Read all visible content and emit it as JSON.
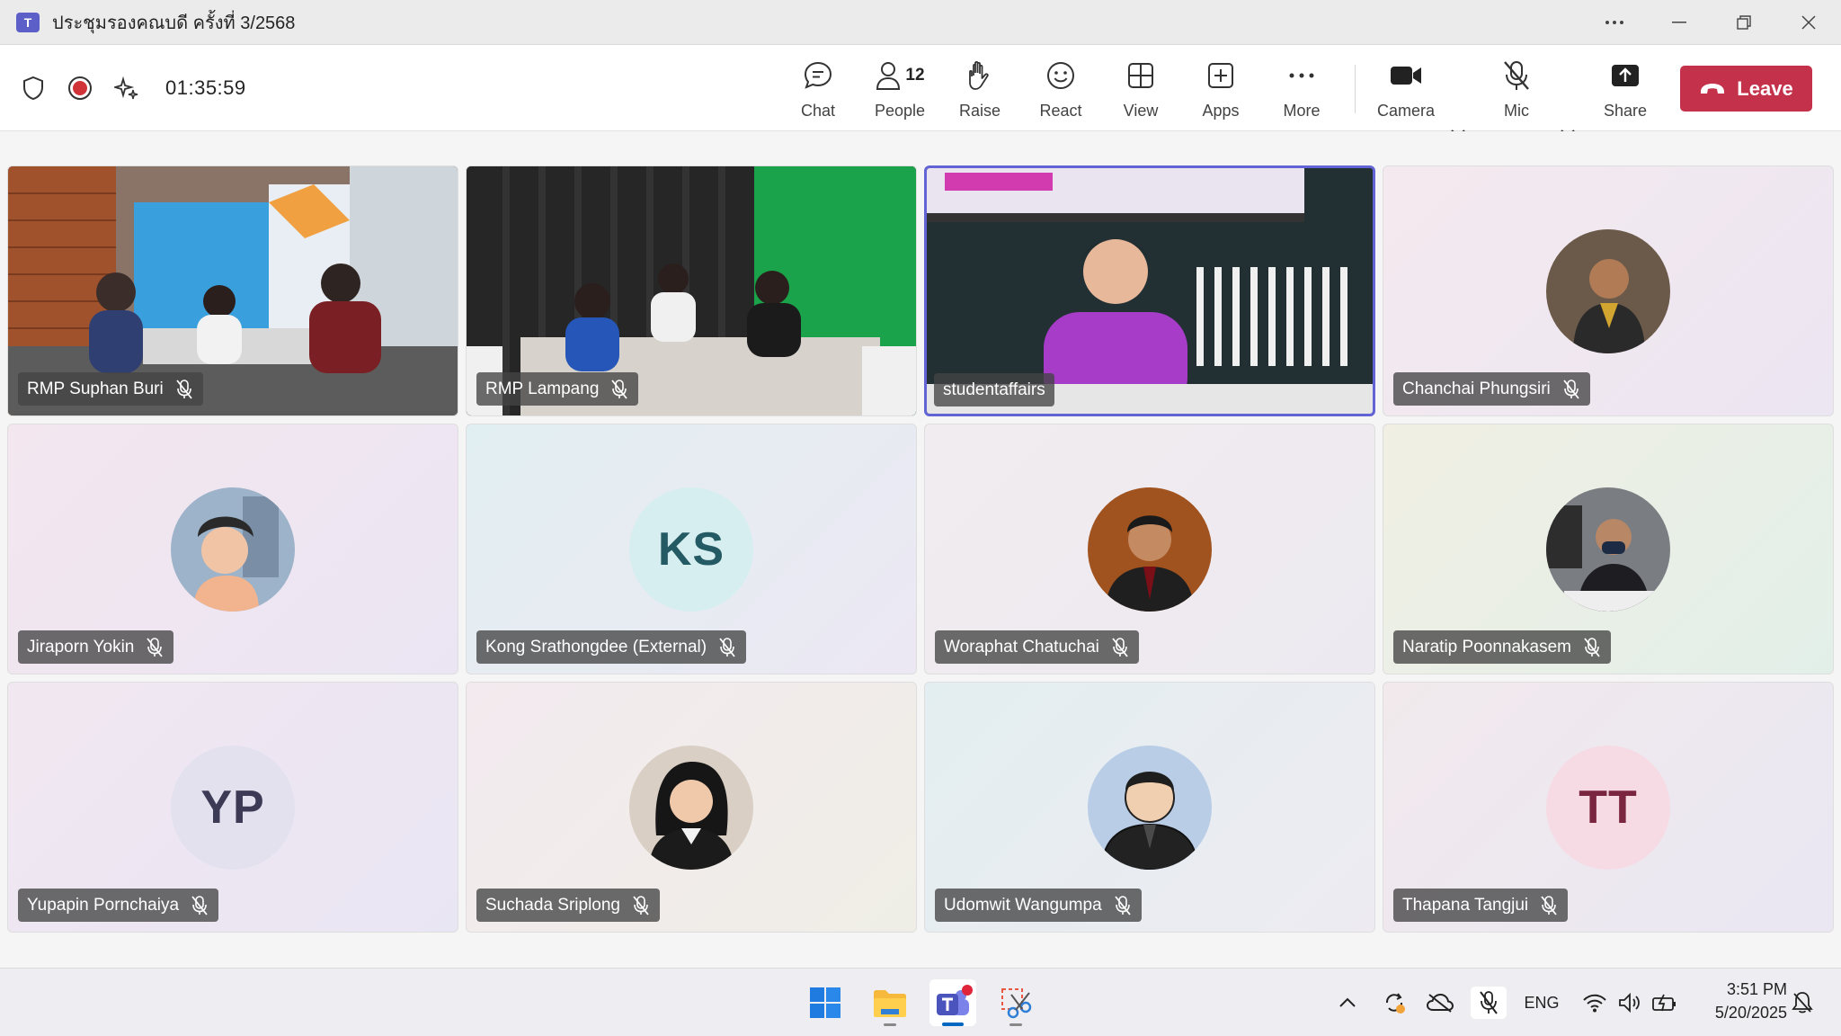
{
  "window": {
    "title": "ประชุมรองคณบดี ครั้งที่ 3/2568",
    "app_logo": "T",
    "controls": [
      "more-icon",
      "minimize-icon",
      "restore-icon",
      "close-icon"
    ]
  },
  "meeting": {
    "timer": "01:35:59",
    "toolbar": {
      "chat": "Chat",
      "people": "People",
      "people_count": "12",
      "raise": "Raise",
      "react": "React",
      "view": "View",
      "apps": "Apps",
      "more": "More",
      "camera": "Camera",
      "mic": "Mic",
      "share": "Share",
      "leave": "Leave"
    }
  },
  "participants": [
    {
      "name": "RMP Suphan Buri",
      "kind": "video",
      "scene": "room-brick"
    },
    {
      "name": "RMP Lampang",
      "kind": "video",
      "scene": "room-dark"
    },
    {
      "name": "studentaffairs",
      "kind": "video",
      "scene": "speaker",
      "active": true
    },
    {
      "name": "Chanchai Phungsiri",
      "kind": "photo"
    },
    {
      "name": "Jiraporn Yokin",
      "kind": "photo"
    },
    {
      "name": "Kong Srathongdee (External)",
      "kind": "initials",
      "initials": "KS"
    },
    {
      "name": "Woraphat Chatuchai",
      "kind": "photo"
    },
    {
      "name": "Naratip Poonnakasem",
      "kind": "photo"
    },
    {
      "name": "Yupapin Pornchaiya",
      "kind": "initials",
      "initials": "YP"
    },
    {
      "name": "Suchada Sriplong",
      "kind": "photo"
    },
    {
      "name": "Udomwit Wangumpa",
      "kind": "photo"
    },
    {
      "name": "Thapana Tangjui",
      "kind": "initials",
      "initials": "TT"
    }
  ],
  "colors": {
    "accent": "#5b5fc7",
    "leave": "#c4314b",
    "active_border": "#6264d6"
  },
  "taskbar": {
    "language": "ENG",
    "time": "3:51 PM",
    "date": "5/20/2025"
  }
}
